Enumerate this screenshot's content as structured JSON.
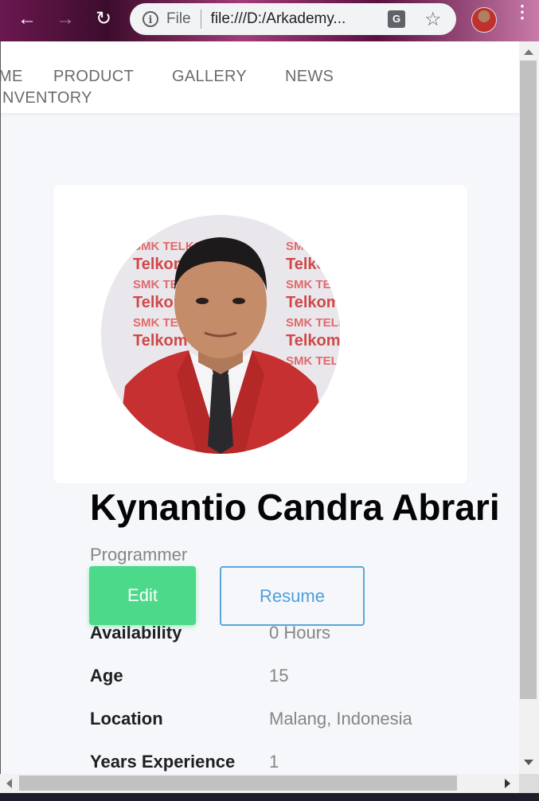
{
  "browser": {
    "scheme_label": "File",
    "url": "file:///D:/Arkademy...",
    "translate_glyph": "G",
    "back_glyph": "←",
    "forward_glyph": "→",
    "reload_glyph": "↻",
    "star_glyph": "☆",
    "menu_glyph": "⋮",
    "info_glyph": "i"
  },
  "nav": {
    "items": [
      {
        "label": "ME"
      },
      {
        "label": "PRODUCT"
      },
      {
        "label": "GALLERY"
      },
      {
        "label": "NEWS"
      },
      {
        "label": "NVENTORY"
      }
    ]
  },
  "profile": {
    "name": "Kynantio Candra Abrari",
    "role": "Programmer",
    "photo_text_pattern": [
      "SMK TELKOM",
      "Telkom"
    ],
    "edit_label": "Edit",
    "resume_label": "Resume",
    "details": [
      {
        "label": "Availability",
        "value": "0 Hours"
      },
      {
        "label": "Age",
        "value": "15"
      },
      {
        "label": "Location",
        "value": "Malang, Indonesia"
      },
      {
        "label": "Years Experience",
        "value": "1"
      }
    ]
  },
  "colors": {
    "edit_bg": "#4cd98a",
    "resume_border": "#5aa6dc",
    "page_bg": "#f6f7fb",
    "blazer": "#c73030"
  }
}
